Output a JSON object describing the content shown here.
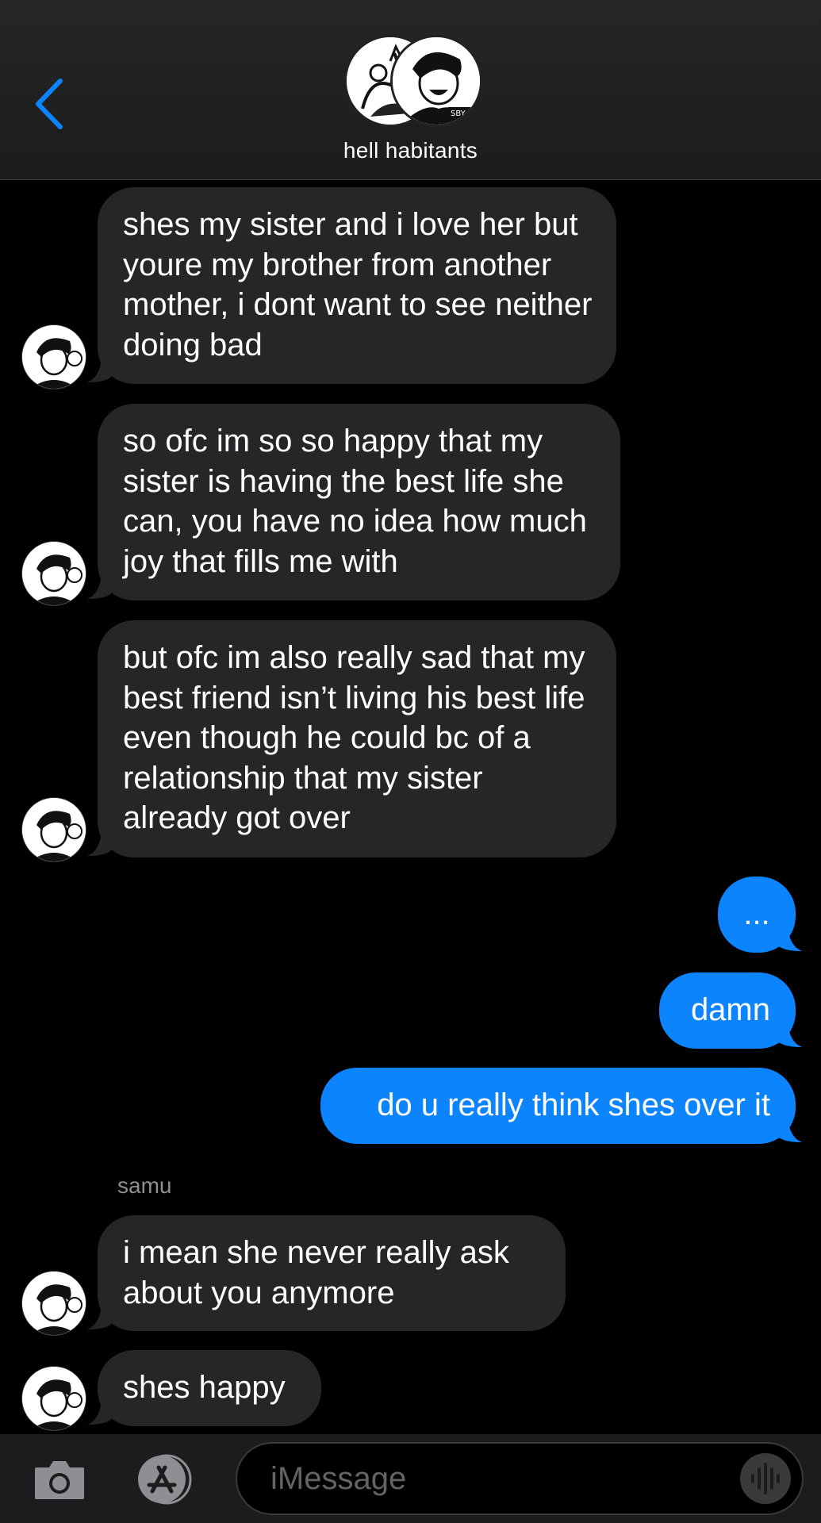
{
  "header": {
    "group_name": "hell habitants",
    "back_icon": "chevron-left-icon",
    "accent": "#0b84fe"
  },
  "messages": [
    {
      "id": "m1",
      "direction": "incoming",
      "text": "shes my sister and i love her but youre my brother from another mother, i dont want to see neither doing bad"
    },
    {
      "id": "m2",
      "direction": "incoming",
      "text": "so ofc im so so happy that my sister is having the best life she can, you have no idea how much joy that fills me with"
    },
    {
      "id": "m3",
      "direction": "incoming",
      "text": "but ofc im also really sad that my best friend isn’t living his best life even though he could bc of a relationship that my sister already got over"
    },
    {
      "id": "m4",
      "direction": "outgoing",
      "text": "..."
    },
    {
      "id": "m5",
      "direction": "outgoing",
      "text": "damn"
    },
    {
      "id": "m6",
      "direction": "outgoing",
      "text": "do u really think shes over it"
    },
    {
      "id": "m7",
      "direction": "incoming",
      "sender": "samu",
      "text": "i mean she never really ask about you anymore"
    },
    {
      "id": "m8",
      "direction": "incoming",
      "text": "shes happy"
    }
  ],
  "composer": {
    "placeholder": "iMessage",
    "camera_icon": "camera-icon",
    "apps_icon": "app-store-icon",
    "audio_icon": "audio-waveform-icon"
  },
  "colors": {
    "incoming_bubble": "#262628",
    "outgoing_bubble": "#0b84fe",
    "background": "#000000"
  }
}
